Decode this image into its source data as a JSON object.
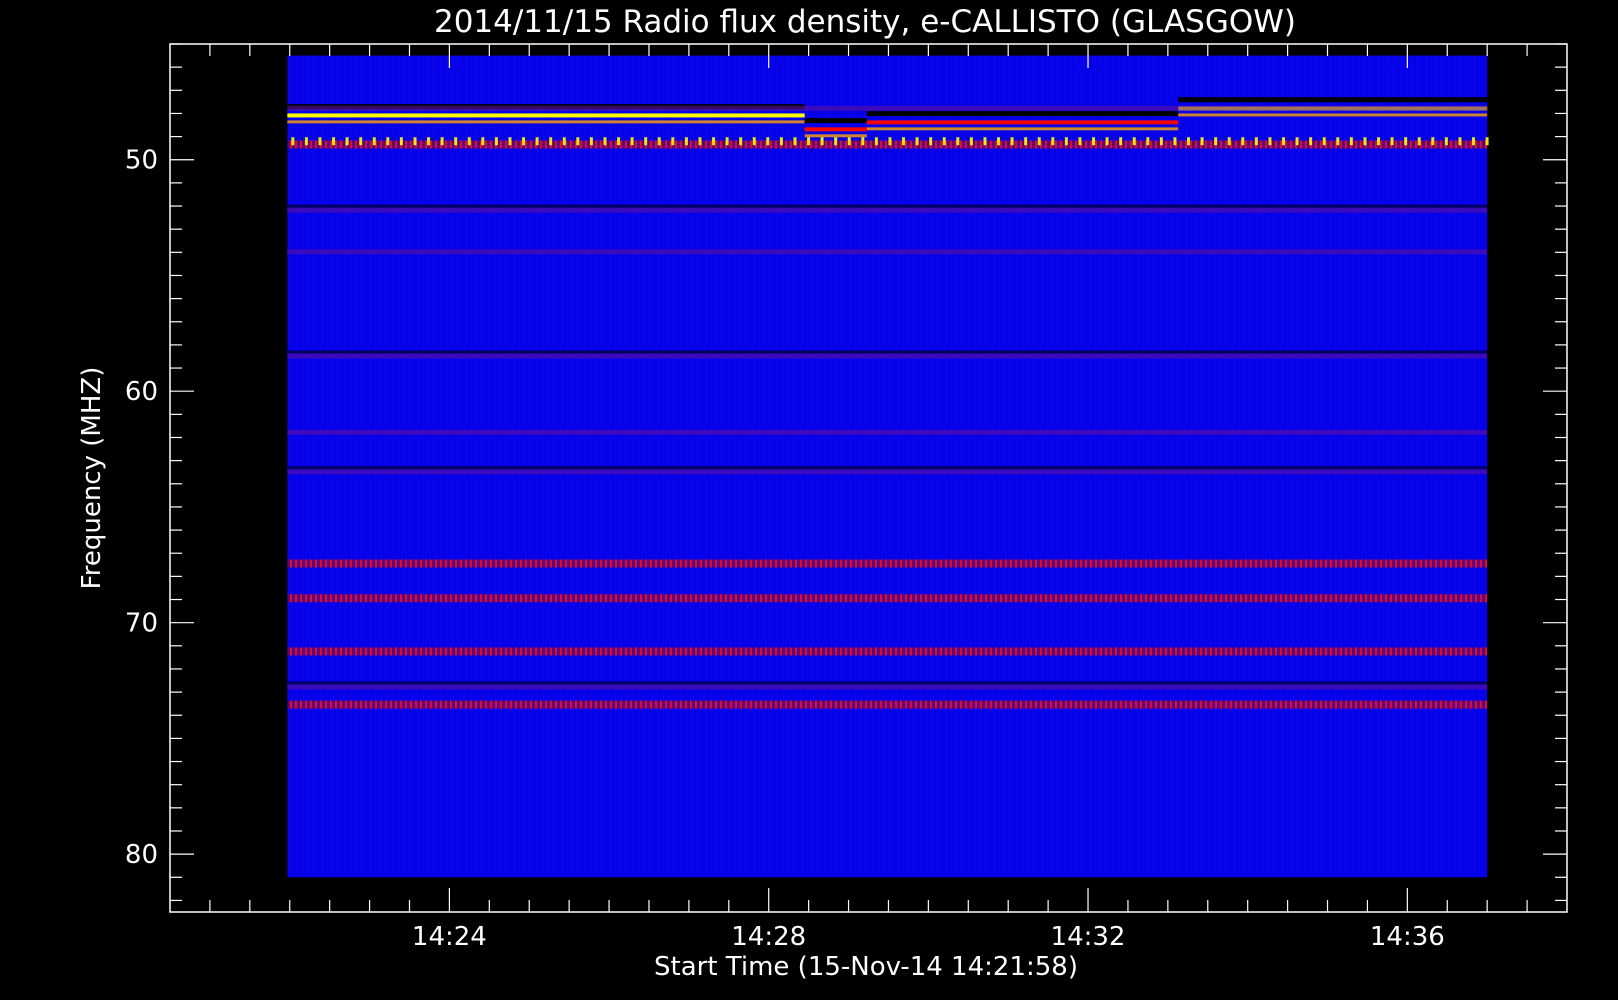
{
  "chart_data": {
    "type": "heatmap",
    "title": "2014/11/15  Radio flux density, e-CALLISTO (GLASGOW)",
    "xlabel": "Start Time (15-Nov-14 14:21:58)",
    "ylabel": "Frequency (MHZ)",
    "x_ticks": [
      "14:24",
      "14:28",
      "14:32",
      "14:36"
    ],
    "x_tick_minutes": [
      24,
      28,
      32,
      36
    ],
    "y_ticks": [
      "50",
      "60",
      "70",
      "80"
    ],
    "y_tick_values": [
      50,
      60,
      70,
      80
    ],
    "xlim_minutes": [
      20.5,
      38.0
    ],
    "ylim_mhz": [
      45.0,
      82.5
    ],
    "data_time_range_minutes": [
      21.97,
      37.0
    ],
    "data_freq_range_mhz": [
      45.5,
      81.0
    ],
    "y_axis_inverted": true,
    "segment_boundaries_minutes": [
      28.45,
      29.23,
      33.13
    ],
    "band_frequencies_mhz": [
      47.8,
      49.3,
      52.2,
      54.0,
      58.5,
      61.8,
      63.5,
      67.4,
      68.9,
      71.2,
      72.8,
      73.5
    ],
    "colors": {
      "background": "#0000ee",
      "strong": "#ff0000",
      "peak": "#ffff00",
      "gap": "#000000",
      "frame": "#000000",
      "axes": "#ffffff"
    }
  }
}
